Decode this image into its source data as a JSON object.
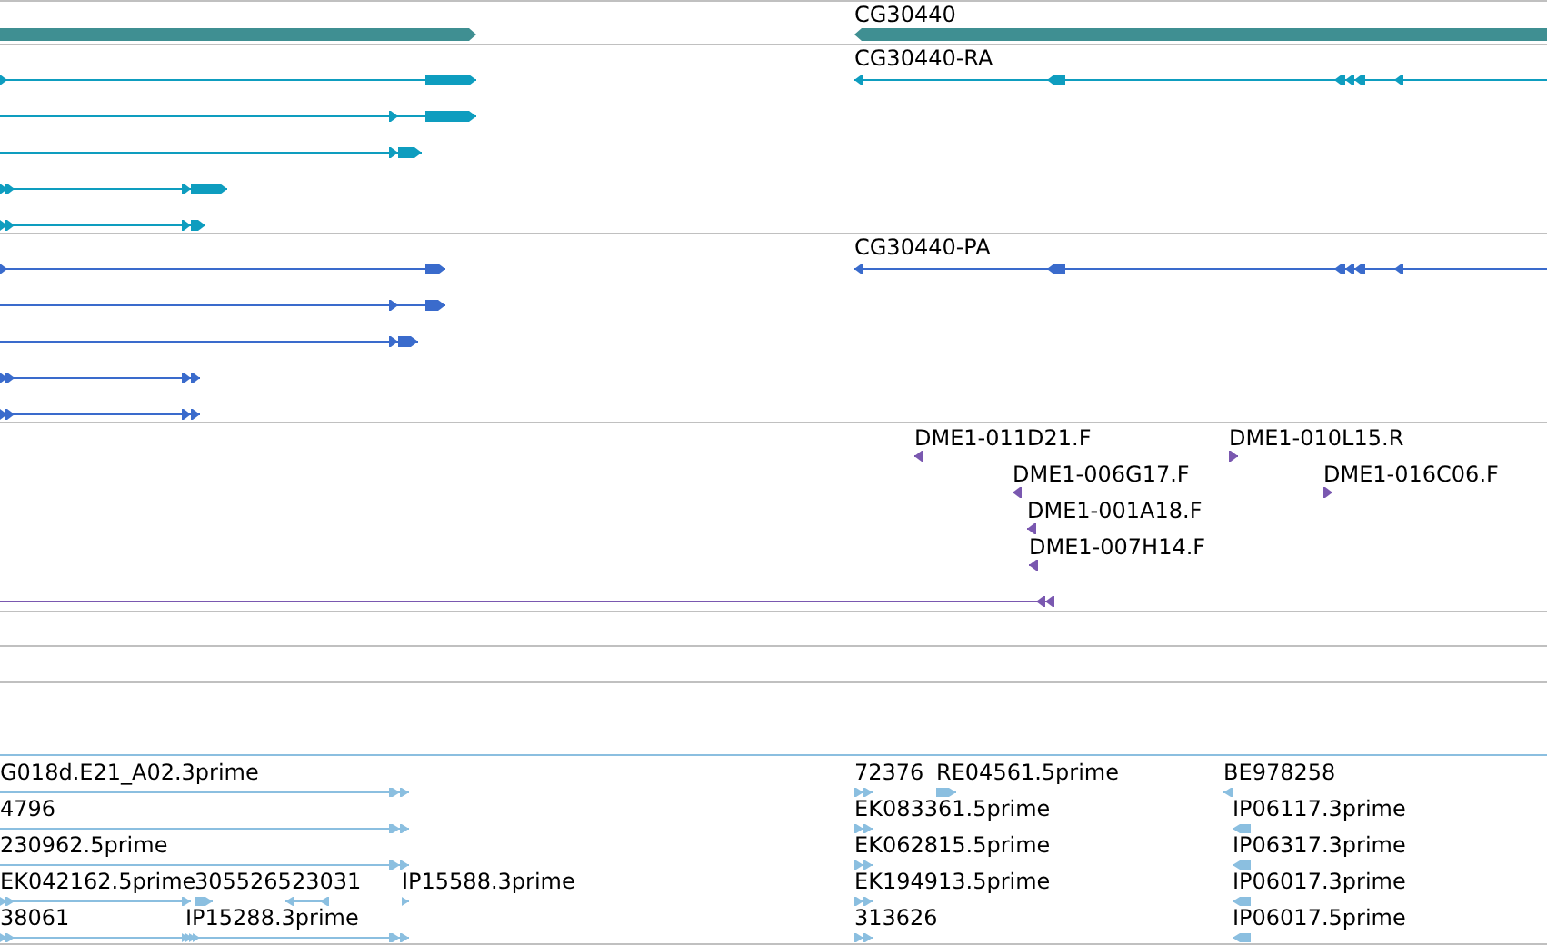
{
  "tracks": [
    {
      "kind": "gene",
      "features": [
        {
          "reverse": false
        },
        {
          "label": "CG30440",
          "reverse": true
        }
      ]
    },
    {
      "kind": "mrna",
      "features": [
        {
          "reverse": false
        },
        {
          "reverse": false
        },
        {
          "reverse": false
        },
        {
          "reverse": false
        },
        {
          "reverse": false
        },
        {
          "label": "CG30440-RA",
          "reverse": true
        }
      ]
    },
    {
      "kind": "protein",
      "features": [
        {
          "reverse": false
        },
        {
          "reverse": false
        },
        {
          "reverse": false
        },
        {
          "reverse": false
        },
        {
          "reverse": false
        },
        {
          "label": "CG30440-PA",
          "reverse": true
        }
      ]
    },
    {
      "kind": "clone",
      "features": [
        {
          "label": "DME1-011D21.F",
          "reverse": true
        },
        {
          "label": "DME1-010L15.R",
          "reverse": false
        },
        {
          "label": "DME1-006G17.F",
          "reverse": true
        },
        {
          "label": "DME1-016C06.F",
          "reverse": false
        },
        {
          "label": "DME1-001A18.F",
          "reverse": true
        },
        {
          "label": "DME1-007H14.F",
          "reverse": true
        },
        {
          "reverse": true
        }
      ]
    },
    {
      "kind": "empty"
    },
    {
      "kind": "empty"
    },
    {
      "kind": "empty"
    },
    {
      "kind": "est",
      "features": [
        {
          "label": "G018d.E21_A02.3prime",
          "reverse": false
        },
        {
          "label": "72376",
          "reverse": false
        },
        {
          "label": "RE04561.5prime",
          "reverse": false
        },
        {
          "label": "BE978258",
          "reverse": true
        },
        {
          "label": "4796",
          "reverse": false
        },
        {
          "label": "EK083361.5prime",
          "reverse": false
        },
        {
          "label": "IP06117.3prime",
          "reverse": true
        },
        {
          "label": "230962.5prime",
          "reverse": false
        },
        {
          "label": "EK062815.5prime",
          "reverse": false
        },
        {
          "label": "IP06317.3prime",
          "reverse": true
        },
        {
          "label": "EK042162.5prime",
          "reverse": false
        },
        {
          "label": "305526523031",
          "reverse": false
        },
        {
          "reverse": true
        },
        {
          "label": "IP15588.3prime",
          "reverse": false
        },
        {
          "label": "EK194913.5prime",
          "reverse": false
        },
        {
          "label": "IP06017.3prime",
          "reverse": true
        },
        {
          "label": "38061",
          "reverse": false
        },
        {
          "label": "IP15288.3prime",
          "reverse": false
        },
        {
          "label": "313626",
          "reverse": false
        },
        {
          "label": "IP06017.5prime",
          "reverse": true
        }
      ]
    }
  ]
}
